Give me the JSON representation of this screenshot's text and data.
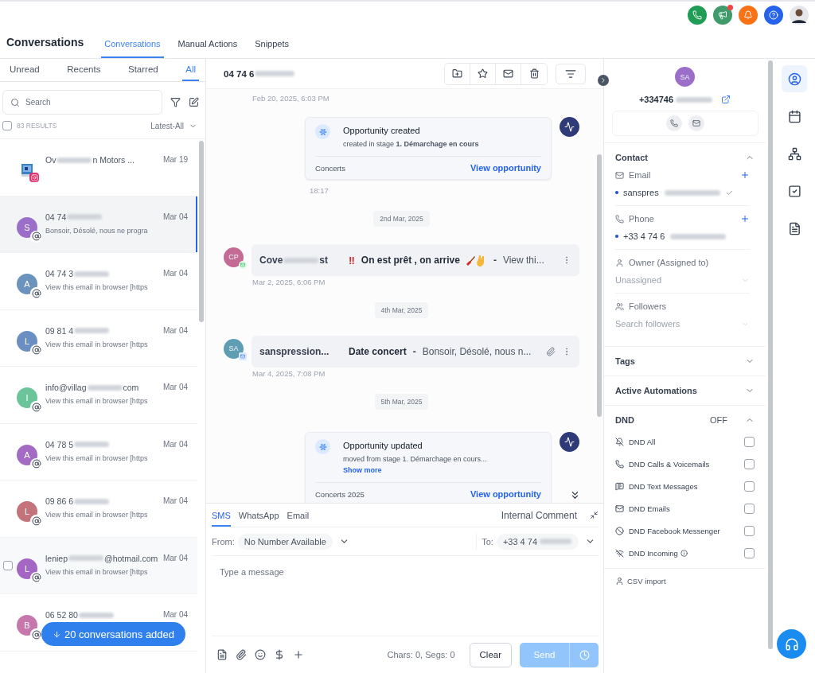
{
  "top_bar": {
    "buttons": [
      {
        "kind": "phone",
        "badge": false
      },
      {
        "kind": "megaphone",
        "badge": true
      },
      {
        "kind": "bell",
        "badge": false
      },
      {
        "kind": "help",
        "badge": false
      },
      {
        "kind": "avatar",
        "badge": false
      }
    ]
  },
  "header": {
    "title": "Conversations",
    "tabs": [
      {
        "label": "Conversations",
        "selected": true
      },
      {
        "label": "Manual Actions",
        "selected": false
      },
      {
        "label": "Snippets",
        "selected": false
      }
    ]
  },
  "inbox": {
    "tabs": [
      {
        "label": "Unread",
        "selected": false
      },
      {
        "label": "Recents",
        "selected": false
      },
      {
        "label": "Starred",
        "selected": false
      },
      {
        "label": "All",
        "selected": true
      }
    ],
    "search": {
      "placeholder": "Search"
    },
    "select_all": {
      "checked": false
    },
    "results": "83 RESULTS",
    "sort": "Latest-All",
    "conversations": [
      {
        "name": [
          "Ov",
          "n Motors ..."
        ],
        "trailing_blur": false,
        "date": "Mar 19",
        "avatar": {
          "kind": "picture"
        },
        "kind": "instagram",
        "selected": false,
        "hovered": false
      },
      {
        "name": [
          "04 74"
        ],
        "trailing_blur": true,
        "date": "Mar 04",
        "preview": "Bonsoir, Désolé, nous ne progra",
        "avatar": {
          "kind": "letter",
          "letter": "S",
          "color": "#9b6fc9"
        },
        "kind": "email",
        "selected": true,
        "hovered": false
      },
      {
        "name": [
          "04 74 3"
        ],
        "trailing_blur": true,
        "date": "Mar 04",
        "preview": "View this email in browser [https",
        "avatar": {
          "kind": "letter",
          "letter": "A",
          "color": "#6b93bd"
        },
        "kind": "email",
        "selected": false,
        "hovered": false
      },
      {
        "name": [
          "09 81 4"
        ],
        "trailing_blur": true,
        "date": "Mar 04",
        "preview": "View this email in browser [https",
        "avatar": {
          "kind": "letter",
          "letter": "L",
          "color": "#6b8fc2"
        },
        "kind": "email",
        "selected": false,
        "hovered": false
      },
      {
        "name": [
          "info@villag",
          "com"
        ],
        "trailing_blur": false,
        "date": "Mar 04",
        "preview": "View this email in browser [https",
        "avatar": {
          "kind": "letter",
          "letter": "I",
          "color": "#6cc49a"
        },
        "kind": "email",
        "selected": false,
        "hovered": false
      },
      {
        "name": [
          "04 78 5"
        ],
        "trailing_blur": true,
        "date": "Mar 04",
        "preview": "View this email in browser [https",
        "avatar": {
          "kind": "letter",
          "letter": "A",
          "color": "#a46bc4"
        },
        "kind": "email",
        "selected": false,
        "hovered": false
      },
      {
        "name": [
          "09 86 6"
        ],
        "trailing_blur": true,
        "date": "Mar 04",
        "preview": "View this email in browser [https",
        "avatar": {
          "kind": "letter",
          "letter": "L",
          "color": "#c4737a"
        },
        "kind": "email",
        "selected": false,
        "hovered": false
      },
      {
        "name": [
          "leniep",
          "@hotmail.com"
        ],
        "trailing_blur": false,
        "date": "Mar 04",
        "preview": "View this email in browser [https",
        "avatar": {
          "kind": "letter",
          "letter": "L",
          "color": "#a565c4"
        },
        "kind": "email",
        "selected": false,
        "hovered": true
      },
      {
        "name": [
          "06 52 80"
        ],
        "trailing_blur": true,
        "date": "Mar 04",
        "avatar": {
          "kind": "letter",
          "letter": "B",
          "color": "#c678ad"
        },
        "kind": "email",
        "selected": false,
        "hovered": false
      }
    ],
    "toast": "20 conversations added"
  },
  "thread": {
    "title": "04 74 6",
    "toolbar": [
      {
        "kind": "folder-plus"
      },
      {
        "kind": "star"
      },
      {
        "kind": "mail"
      },
      {
        "kind": "trash"
      }
    ],
    "items": [
      {
        "kind": "time",
        "text": "Feb 20, 2025, 6:03 PM",
        "indent": false
      },
      {
        "kind": "activity",
        "title": "Opportunity created",
        "detail": "created in stage **1. Démarchage en cours**",
        "pipeline": "Concerts",
        "link": "View opportunity"
      },
      {
        "kind": "time",
        "text": "18:17",
        "indent": true
      },
      {
        "kind": "date",
        "text": "2nd Mar, 2025"
      },
      {
        "kind": "message",
        "avatar": "CP",
        "color": "#c36b95",
        "sender": [
          "Cove",
          "st"
        ],
        "mark": "‼",
        "subject": "On est prêt , on arrive",
        "emoji": true,
        "separator": "-",
        "snippet": "View thi...",
        "attachment": false
      },
      {
        "kind": "time",
        "text": "Mar 2, 2025, 6:06 PM",
        "indent": false
      },
      {
        "kind": "date",
        "text": "4th Mar, 2025"
      },
      {
        "kind": "message",
        "avatar": "SA",
        "color": "#5f9db3",
        "sender": [
          "sanspression..."
        ],
        "subject": "Date concert",
        "emoji": false,
        "separator": "-",
        "snippet": "Bonsoir, Désolé, nous n...",
        "attachment": true
      },
      {
        "kind": "time",
        "text": "Mar 4, 2025, 7:08 PM",
        "indent": false
      },
      {
        "kind": "date",
        "text": "5th Mar, 2025"
      },
      {
        "kind": "activity",
        "title": "Opportunity updated",
        "detail": "moved from stage 1. Démarchage en cours...",
        "more": "Show more",
        "pipeline": "Concerts 2025",
        "link": "View opportunity"
      }
    ]
  },
  "composer": {
    "tabs": [
      {
        "label": "SMS",
        "selected": true
      },
      {
        "label": "WhatsApp",
        "selected": false
      },
      {
        "label": "Email",
        "selected": false
      }
    ],
    "internal": "Internal Comment",
    "from_label": "From:",
    "from_value": "No Number Available",
    "to_label": "To:",
    "to_value": "+33 4 74",
    "placeholder": "Type a message",
    "counter": "Chars: 0, Segs: 0",
    "clear": "Clear",
    "send": "Send",
    "send_disabled": true
  },
  "contact": {
    "avatar": "SA",
    "phone": "+334746",
    "sections": [
      {
        "title": "Contact",
        "expanded": true,
        "fields": [
          {
            "kind": "value",
            "label": "Email",
            "add": true,
            "value": "sanspres",
            "verified": true
          },
          {
            "kind": "value",
            "label": "Phone",
            "add": true,
            "value": "+33 4 74 6",
            "verified": false
          },
          {
            "kind": "select",
            "label": "Owner (Assigned to)",
            "placeholder": "Unassigned"
          },
          {
            "kind": "select",
            "label": "Followers",
            "placeholder": "Search followers"
          }
        ]
      },
      {
        "title": "Tags",
        "expanded": false
      },
      {
        "title": "Active Automations",
        "expanded": false
      },
      {
        "title": "DND",
        "status": "OFF",
        "expanded": true,
        "options": [
          {
            "label": "DND All",
            "checked": false,
            "info": false
          },
          {
            "label": "DND Calls & Voicemails",
            "checked": false,
            "info": false
          },
          {
            "label": "DND Text Messages",
            "checked": false,
            "info": false
          },
          {
            "label": "DND Emails",
            "checked": false,
            "info": false
          },
          {
            "label": "DND Facebook Messenger",
            "checked": false,
            "info": false
          },
          {
            "label": "DND Incoming",
            "checked": false,
            "info": true
          }
        ]
      }
    ],
    "footer": "CSV import"
  },
  "rail": [
    {
      "kind": "user",
      "selected": true
    },
    {
      "kind": "calendar",
      "selected": false
    },
    {
      "kind": "network",
      "selected": false
    },
    {
      "kind": "check",
      "selected": false
    },
    {
      "kind": "file",
      "selected": false
    }
  ]
}
